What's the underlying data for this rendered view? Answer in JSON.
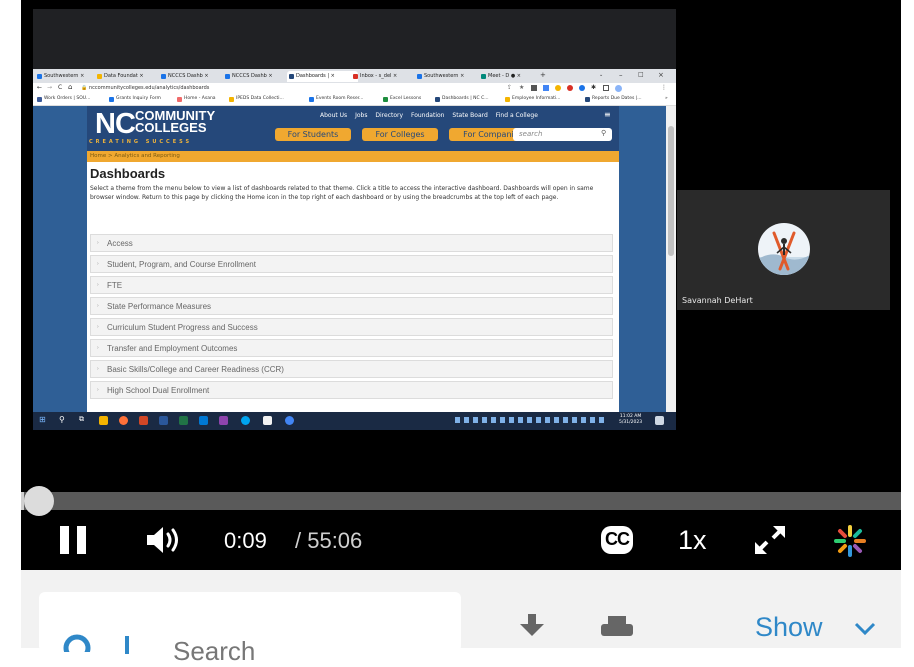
{
  "browser": {
    "tabs": [
      {
        "label": "Southwestern",
        "color": "#1a73e8"
      },
      {
        "label": "Data Foundat",
        "color": "#f4b400"
      },
      {
        "label": "NCCCS Dashb",
        "color": "#1a73e8"
      },
      {
        "label": "NCCCS Dashb",
        "color": "#1a73e8"
      },
      {
        "label": "Dashboards |",
        "color": "#25487a"
      },
      {
        "label": "Inbox - s_del",
        "color": "#d93025"
      },
      {
        "label": "Southwestern",
        "color": "#1a73e8"
      },
      {
        "label": "Meet - D",
        "color": "#00897b"
      }
    ],
    "url": "nccommunitycolleges.edu/analytics/dashboards",
    "bookmarks": [
      {
        "label": "Work Orders | SOU...",
        "color": "#3b5998"
      },
      {
        "label": "Grants Inquiry Form",
        "color": "#1a73e8"
      },
      {
        "label": "Home - Asana",
        "color": "#f06a6a"
      },
      {
        "label": "IPEDS Data Collecti...",
        "color": "#f4b400"
      },
      {
        "label": "Events Room Reser...",
        "color": "#1a73e8"
      },
      {
        "label": "Excel Lessons",
        "color": "#1e8e3e"
      },
      {
        "label": "Dashboards | NC C...",
        "color": "#25487a"
      },
      {
        "label": "Employee Informati...",
        "color": "#f4b400"
      },
      {
        "label": "Reports Due Dates |...",
        "color": "#25487a"
      }
    ]
  },
  "site": {
    "logo_nc": "NC",
    "logo_line1": "COMMUNITY",
    "logo_line2": "COLLEGES",
    "logo_tagline": "CREATING SUCCESS",
    "top_nav": [
      "About Us",
      "Jobs",
      "Directory",
      "Foundation",
      "State Board",
      "Find a College"
    ],
    "audience_buttons": [
      "For Students",
      "For Colleges",
      "For Companies"
    ],
    "search_placeholder": "search",
    "breadcrumb": "Home > Analytics and Reporting",
    "page_title": "Dashboards",
    "intro": "Select a theme from the menu below to view a list of dashboards related to that theme. Click a title to access the interactive dashboard. Dashboards will open in same browser window. Return to this page by clicking the Home icon in the top right of each dashboard or by using the breadcrumbs at the top left of each page.",
    "themes": [
      "Access",
      "Student, Program, and Course Enrollment",
      "FTE",
      "State Performance Measures",
      "Curriculum Student Progress and Success",
      "Transfer and Employment Outcomes",
      "Basic Skills/College and Career Readiness (CCR)",
      "High School Dual Enrollment"
    ]
  },
  "taskbar": {
    "time": "11:02 AM",
    "date": "5/31/2023"
  },
  "participant": {
    "name": "Savannah DeHart"
  },
  "player": {
    "progress": 0.0027,
    "current_time": "0:09",
    "duration": "/ 55:06",
    "speed": "1x",
    "cc_label": "CC"
  },
  "toolbar": {
    "search_placeholder": "Search",
    "show_label": "Show"
  },
  "colors": {
    "nc_blue": "#25487a",
    "nc_gold": "#f0a830",
    "link_blue": "#2f88c8"
  }
}
